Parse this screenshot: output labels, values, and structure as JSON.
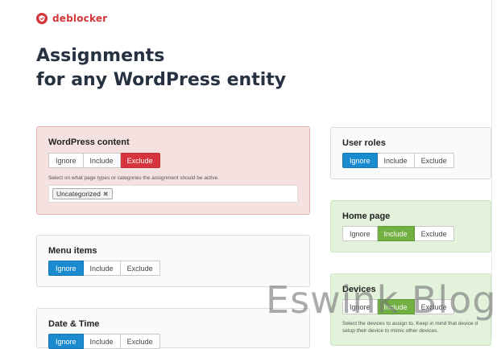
{
  "brand": {
    "name": "deblocker",
    "logo_icon": "shield-icon",
    "color": "#d6363b"
  },
  "title": {
    "line1": "Assignments",
    "line2": "for any WordPress entity"
  },
  "cards": {
    "wordpress_content": {
      "title": "WordPress content",
      "buttons": [
        "Ignore",
        "Include",
        "Exclude"
      ],
      "selected": "Exclude",
      "help": "Select on what page types or categories the assignment should be active.",
      "tags": [
        "Uncategorized"
      ]
    },
    "menu_items": {
      "title": "Menu items",
      "buttons": [
        "Ignore",
        "Include",
        "Exclude"
      ],
      "selected": "Ignore"
    },
    "date_time": {
      "title": "Date & Time",
      "buttons": [
        "Ignore",
        "Include",
        "Exclude"
      ],
      "selected": "Ignore"
    },
    "user_roles": {
      "title": "User roles",
      "buttons": [
        "Ignore",
        "Include",
        "Exclude"
      ],
      "selected": "Ignore"
    },
    "home_page": {
      "title": "Home page",
      "buttons": [
        "Ignore",
        "Include",
        "Exclude"
      ],
      "selected": "Include"
    },
    "devices": {
      "title": "Devices",
      "buttons": [
        "Ignore",
        "Include",
        "Exclude"
      ],
      "selected": "Include",
      "help_line1": "Select the devices to assign to. Keep in mind that device d",
      "help_line2": "setup their device to mimic other devices."
    }
  },
  "watermark": "Eswink Blog",
  "colors": {
    "blue": "#1b8bd0",
    "green": "#72b043",
    "red": "#d6353d",
    "red_card": "#f6e1e1",
    "green_card": "#e2f2db"
  }
}
